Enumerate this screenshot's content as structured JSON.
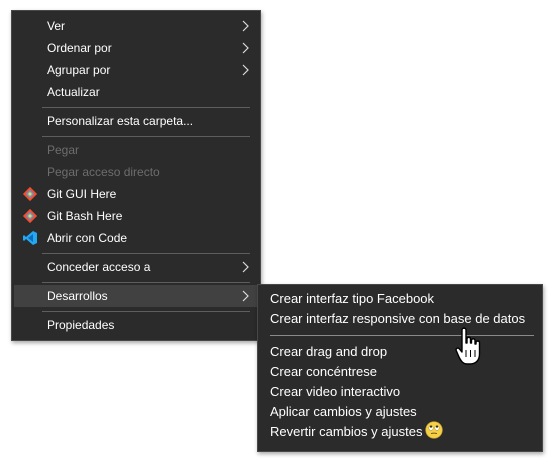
{
  "context_menu": {
    "items": [
      {
        "label": "Ver"
      },
      {
        "label": "Ordenar por"
      },
      {
        "label": "Agrupar por"
      },
      {
        "label": "Actualizar"
      },
      {
        "label": "Personalizar esta carpeta..."
      },
      {
        "label": "Pegar",
        "state": "disabled"
      },
      {
        "label": "Pegar acceso directo",
        "state": "disabled"
      },
      {
        "label": "Git GUI Here",
        "icon": "git-icon"
      },
      {
        "label": "Git Bash Here",
        "icon": "git-icon"
      },
      {
        "label": "Abrir con Code",
        "icon": "vscode-icon"
      },
      {
        "label": "Conceder acceso a"
      },
      {
        "label": "Desarrollos",
        "state": "hover-open"
      },
      {
        "label": "Propiedades"
      }
    ]
  },
  "submenu": {
    "items": [
      {
        "label": "Crear interfaz tipo Facebook"
      },
      {
        "label": "Crear interfaz responsive con base de datos"
      },
      {
        "label": "Crear drag and drop"
      },
      {
        "label": "Crear concéntrese"
      },
      {
        "label": "Crear video interactivo"
      },
      {
        "label": "Aplicar cambios y ajustes"
      },
      {
        "label": "Revertir cambios y ajustes",
        "icon": "eye-roll-emoji-icon"
      }
    ]
  },
  "colors": {
    "menu_background": "#2b2b2b",
    "hover_background": "#414141",
    "text": "#ffffff",
    "disabled_text": "#6d6d6d",
    "git_orange": "#f05032",
    "vscode_blue": "#23a9f2"
  }
}
